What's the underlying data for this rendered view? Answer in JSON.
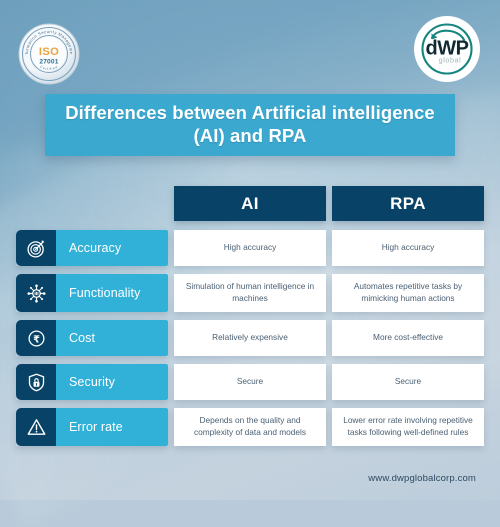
{
  "brand": {
    "iso_badge": {
      "ring_text": "Information Security Management",
      "standard": "ISO",
      "number": "27001",
      "bottom_text": "Certified"
    },
    "logo": {
      "name": "dWP",
      "tagline": "global"
    }
  },
  "title": "Differences between Artificial intelligence (AI) and RPA",
  "table": {
    "header": {
      "label_column": "",
      "columns": [
        "AI",
        "RPA"
      ]
    },
    "rows": [
      {
        "icon": "target-icon",
        "label": "Accuracy",
        "ai": "High accuracy",
        "rpa": "High accuracy"
      },
      {
        "icon": "network-hub-icon",
        "label": "Functionality",
        "ai": "Simulation of human intelligence in machines",
        "rpa": "Automates repetitive tasks by mimicking human actions"
      },
      {
        "icon": "rupee-coin-icon",
        "label": "Cost",
        "ai": "Relatively expensive",
        "rpa": "More cost-effective"
      },
      {
        "icon": "lock-shield-icon",
        "label": "Security",
        "ai": "Secure",
        "rpa": "Secure"
      },
      {
        "icon": "warning-triangle-icon",
        "label": "Error rate",
        "ai": "Depends on the quality and complexity of data and models",
        "rpa": "Lower error rate involving repetitive tasks following well-defined rules"
      }
    ]
  },
  "footer": {
    "website": "www.dwpglobalcorp.com"
  },
  "colors": {
    "title_banner": "#3ba8cf",
    "header_navy": "#084266",
    "label_cyan": "#31b0d8",
    "cell_white": "#ffffff",
    "cell_text": "#4a5f72",
    "footer_text": "#2c4a63",
    "bg_top": "#6d9fbd",
    "bg_bottom": "#bdcddb"
  }
}
